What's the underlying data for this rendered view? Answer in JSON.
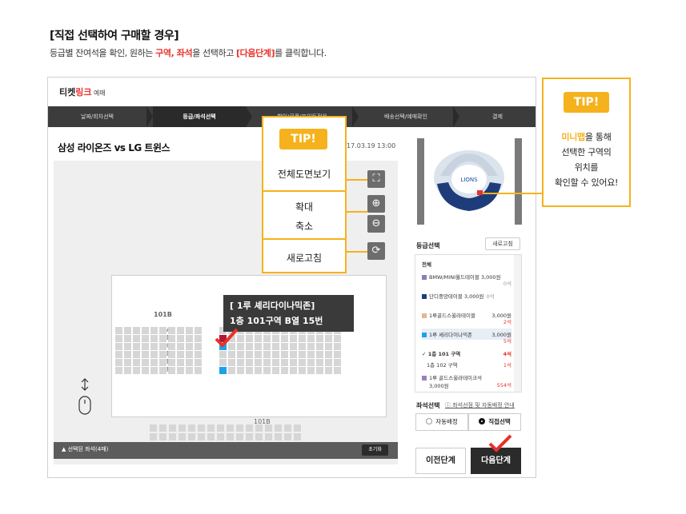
{
  "heading": "[직접 선택하여 구매할 경우]",
  "desc": {
    "pre": "등급별 잔여석을 확인, 원하는 ",
    "hl1": "구역, 좌석",
    "mid": "을 선택하고 ",
    "hl2": "[다음단계]",
    "post": "를 클릭합니다."
  },
  "app": {
    "logo_a": "티켓",
    "logo_b": "링크",
    "logo_c": " 예매"
  },
  "steps": [
    "날짜/회차선택",
    "등급/좌석선택",
    "할인/쿠폰/포인트적용",
    "배송선택/예매확인",
    "결제"
  ],
  "game": {
    "title": "삼성 라이온즈 vs LG 트윈스",
    "date": "17.03.19 13:00"
  },
  "seatmap": {
    "block_top": "101B",
    "block_bottom": "101B",
    "rows": [
      "A",
      "B",
      "C",
      "D",
      "E",
      "F"
    ]
  },
  "tooltip": {
    "line1": "[ 1루 셰리다이나믹존]",
    "line2": "1층 101구역 B열 15번"
  },
  "tip1": {
    "badge": "TIP!",
    "full": "전체도면보기",
    "zoom_in": "확대",
    "zoom_out": "축소",
    "refresh": "새로고침"
  },
  "tip2": {
    "badge": "TIP!",
    "hl": "미니맵",
    "text1": "을 통해",
    "text2": "선택한 구역의",
    "text3": "위치를",
    "text4": "확인할 수 있어요!"
  },
  "bottom": {
    "selected": "▲  선택된 좌석(4매)",
    "reset": "초기화"
  },
  "grade": {
    "title": "등급선택",
    "refresh": "새로고침",
    "all": "전체",
    "items": [
      {
        "name": "BMW/MINI월드테이블 3,000원",
        "count": "0석",
        "color": "#8b7fb5"
      },
      {
        "name": "단디중앙테이블 3,000원",
        "count": "0석",
        "color": "#1f3c7a"
      },
      {
        "name": "1루골드스윌라테이블",
        "price": "3,000원",
        "count": "2석",
        "color": "#e0b98a"
      },
      {
        "name": "1루 셰리다이나믹존",
        "price": "3,000원",
        "count": "5석",
        "color": "#1aa3e8"
      },
      {
        "name": "✓ 1층 101 구역",
        "count": "4석",
        "color": ""
      },
      {
        "name": "1층 102 구역",
        "count": "1석",
        "color": ""
      },
      {
        "name": "1루 골드스윌라테이크석",
        "price": "3,000원",
        "count": "554석",
        "color": "#9a7fc0"
      }
    ]
  },
  "seatsel": {
    "title": "좌석선택",
    "info": "ⓘ 좌석선점 및 자동배정 안내",
    "auto": "자동배정",
    "direct": "직접선택"
  },
  "buttons": {
    "prev": "이전단계",
    "next": "다음단계"
  },
  "colors": {
    "accent": "#e8322a",
    "tip": "#f5b21d",
    "bar": "#3c3c3c"
  }
}
